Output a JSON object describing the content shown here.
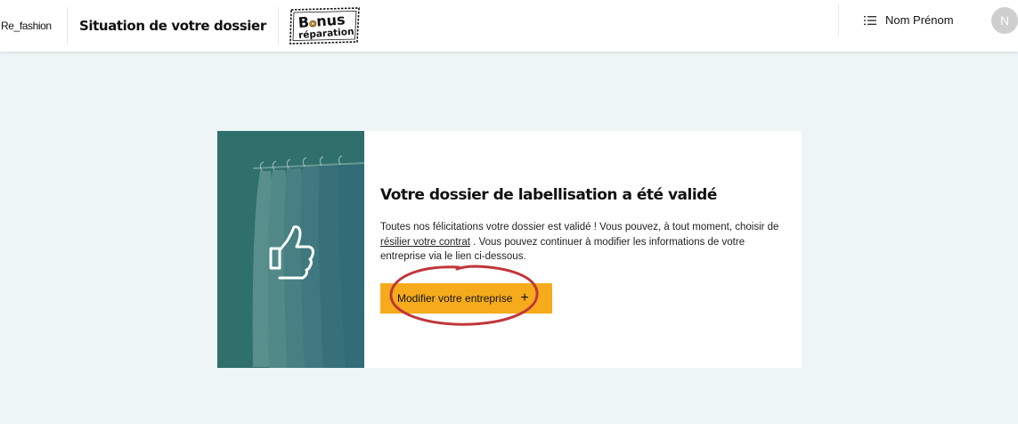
{
  "header": {
    "brand": "Re_fashion",
    "page_title": "Situation de votre dossier",
    "bonus_logo_line1": "Bonus",
    "bonus_logo_line2": "réparation",
    "user_name": "Nom Prénom",
    "avatar_initial": "N",
    "menu_icon": "list-icon"
  },
  "card": {
    "image_icon": "thumbs-up-icon",
    "title": "Votre dossier de labellisation a été validé",
    "text_before_link": "Toutes nos félicitations votre dossier est validé ! Vous pouvez, à tout moment, choisir de ",
    "link_text": "résilier votre contrat",
    "text_after_link": " . Vous pouvez continuer à modifier les informations de votre entreprise via le lien ci-dessous.",
    "button_label": "Modifier votre entreprise",
    "button_icon": "plus-icon"
  },
  "colors": {
    "page_bg": "#edf5f6",
    "button": "#f5ab1b",
    "image_overlay": "#2a6b68",
    "annotation": "#c0363a"
  }
}
